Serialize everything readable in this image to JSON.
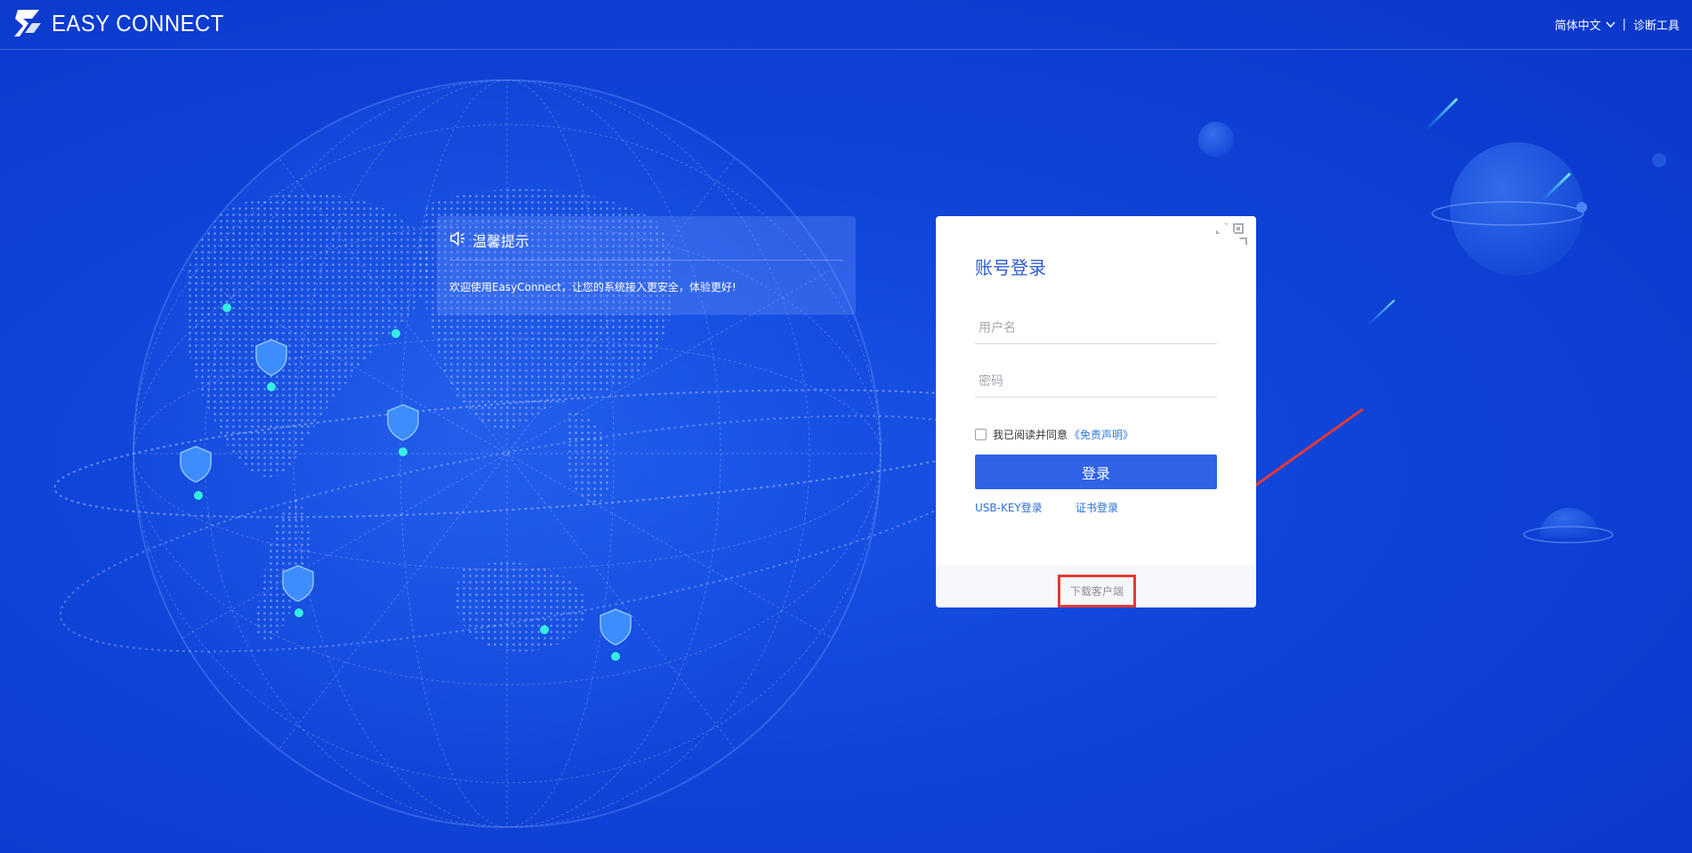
{
  "header": {
    "brand": "EASY CONNECT",
    "language": "简体中文",
    "separator": "|",
    "diagnostic_tool": "诊断工具"
  },
  "notice": {
    "title": "温馨提示",
    "message": "欢迎使用EasyConnect，让您的系统接入更安全，体验更好!"
  },
  "login": {
    "title": "账号登录",
    "username_placeholder": "用户名",
    "password_placeholder": "密码",
    "agree_text": "我已阅读并同意",
    "disclaimer_link": "《免责声明》",
    "submit": "登录",
    "usb_key_login": "USB-KEY登录",
    "cert_login": "证书登录",
    "download_client": "下载客户端"
  },
  "colors": {
    "background": "#0f44d8",
    "accent": "#2f62e6",
    "link": "#2b6fd6",
    "highlight_box": "#e53935",
    "arrow": "#e53935"
  },
  "icons": [
    "logo-icon",
    "chevron-down-icon",
    "speaker-icon",
    "qr-code-icon",
    "shield-pin-icon"
  ]
}
